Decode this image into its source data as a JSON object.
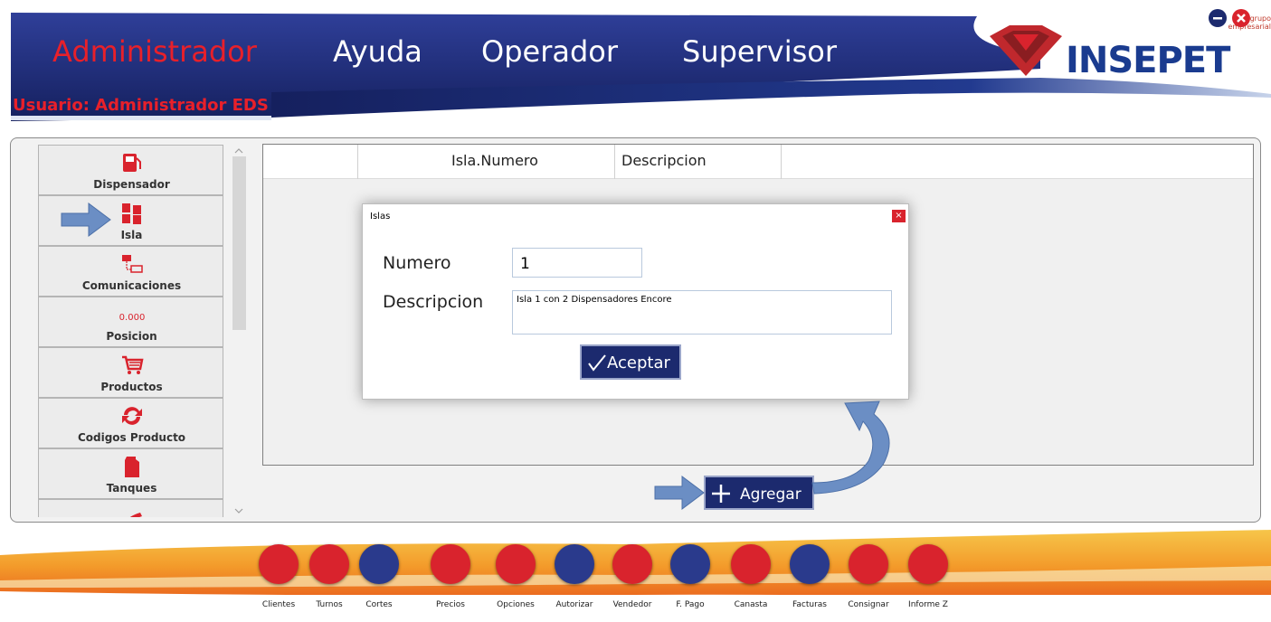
{
  "header": {
    "menus": [
      "Administrador",
      "Ayuda",
      "Operador",
      "Supervisor"
    ],
    "active_menu": "Administrador",
    "user_label": "Usuario: Administrador EDS",
    "logo_text": "INSEPET",
    "logo_sub": "grupo empresarial",
    "brand_blue": "#1a3b8f",
    "brand_red": "#e8202a"
  },
  "sidebar": {
    "items": [
      {
        "label": "Dispensador",
        "icon": "fuel-pump-icon"
      },
      {
        "label": "Isla",
        "icon": "island-icon"
      },
      {
        "label": "Comunicaciones",
        "icon": "network-icon"
      },
      {
        "label": "Posicion",
        "icon": "position-display-icon",
        "glyph": "0.000"
      },
      {
        "label": "Productos",
        "icon": "cart-icon"
      },
      {
        "label": "Codigos Producto",
        "icon": "refresh-icon"
      },
      {
        "label": "Tanques",
        "icon": "tank-icon"
      },
      {
        "label": "",
        "icon": "hose-icon"
      }
    ]
  },
  "grid": {
    "columns": [
      "",
      "Isla.Numero",
      "Descripcion"
    ]
  },
  "dialog": {
    "title": "Islas",
    "close_label": "×",
    "numero_label": "Numero",
    "numero_value": "1",
    "descripcion_label": "Descripcion",
    "descripcion_value": "Isla 1 con 2 Dispensadores Encore",
    "accept_label": "Aceptar"
  },
  "add_button": {
    "label": "Agregar"
  },
  "toolbar": {
    "items": [
      {
        "label": "Clientes",
        "icon": "clients-icon",
        "color": "#d9232d"
      },
      {
        "label": "Turnos",
        "icon": "alarm-clock-icon",
        "color": "#d9232d"
      },
      {
        "label": "Cortes",
        "icon": "scissors-icon",
        "color": "#2a3a8c"
      },
      {
        "label": "Precios",
        "icon": "price-tag-icon",
        "color": "#d9232d"
      },
      {
        "label": "Opciones",
        "icon": "gears-icon",
        "color": "#d9232d"
      },
      {
        "label": "Autorizar",
        "icon": "thumbs-up-icon",
        "color": "#2a3a8c"
      },
      {
        "label": "Vendedor",
        "icon": "id-card-icon",
        "color": "#d9232d"
      },
      {
        "label": "F. Pago",
        "icon": "payment-icon",
        "color": "#2a3a8c"
      },
      {
        "label": "Canasta",
        "icon": "basket-icon",
        "color": "#d9232d"
      },
      {
        "label": "Facturas",
        "icon": "invoice-icon",
        "color": "#2a3a8c"
      },
      {
        "label": "Consignar",
        "icon": "safe-icon",
        "color": "#d9232d"
      },
      {
        "label": "Informe Z",
        "icon": "report-icon",
        "color": "#d9232d"
      }
    ]
  }
}
